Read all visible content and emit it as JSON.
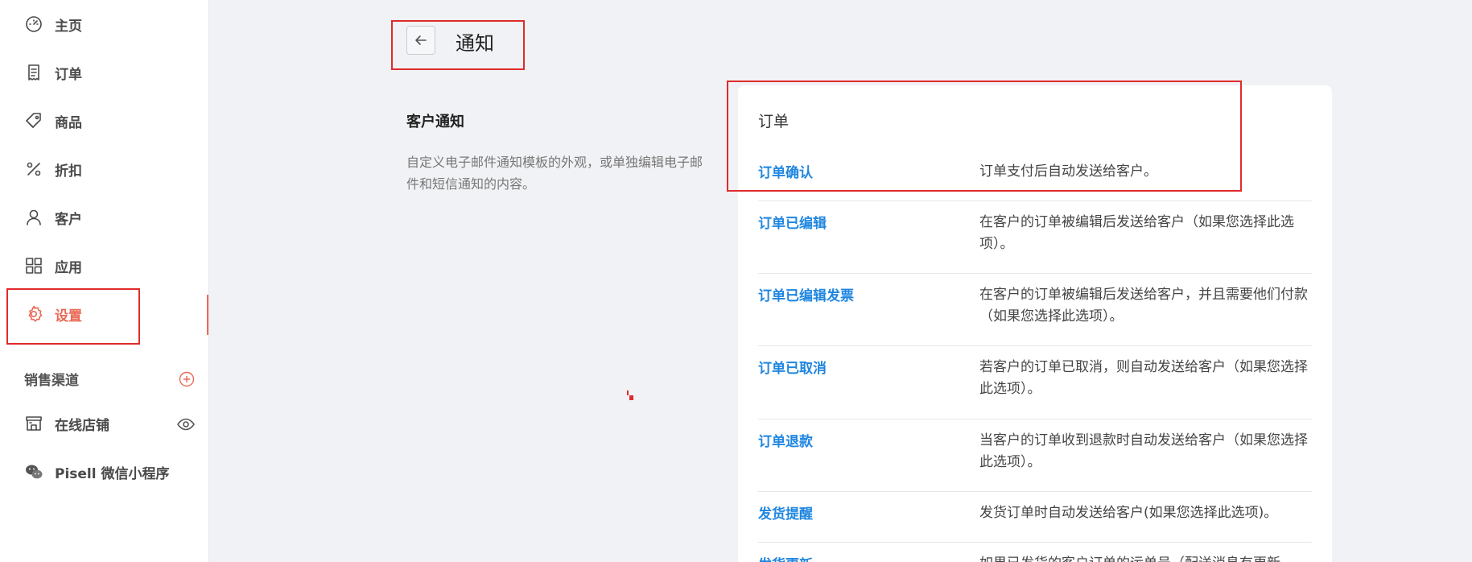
{
  "sidebar": {
    "items": [
      {
        "label": "主页",
        "icon": "dashboard-icon"
      },
      {
        "label": "订单",
        "icon": "receipt-icon"
      },
      {
        "label": "商品",
        "icon": "tag-icon"
      },
      {
        "label": "折扣",
        "icon": "percent-icon"
      },
      {
        "label": "客户",
        "icon": "person-icon"
      },
      {
        "label": "应用",
        "icon": "apps-grid-icon"
      },
      {
        "label": "设置",
        "icon": "gear-icon",
        "active": true
      }
    ],
    "sales_channels_label": "销售渠道",
    "channels": [
      {
        "label": "在线店铺",
        "icon": "store-icon"
      },
      {
        "label": "Pisell 微信小程序",
        "icon": "wechat-icon"
      }
    ],
    "accent_color": "#ea6a57"
  },
  "header": {
    "title": "通知"
  },
  "customer_notifications": {
    "title": "客户通知",
    "description": "自定义电子邮件通知模板的外观，或单独编辑电子邮件和短信通知的内容。"
  },
  "card": {
    "title": "订单",
    "rows": [
      {
        "name": "订单确认",
        "desc": "订单支付后自动发送给客户。"
      },
      {
        "name": "订单已编辑",
        "desc": "在客户的订单被编辑后发送给客户（如果您选择此选项）。"
      },
      {
        "name": "订单已编辑发票",
        "desc": "在客户的订单被编辑后发送给客户，并且需要他们付款（如果您选择此选项）。"
      },
      {
        "name": "订单已取消",
        "desc": "若客户的订单已取消，则自动发送给客户（如果您选择此选项）。"
      },
      {
        "name": "订单退款",
        "desc": "当客户的订单收到退款时自动发送给客户（如果您选择此选项）。"
      },
      {
        "name": "发货提醒",
        "desc": "发货订单时自动发送给客户(如果您选择此选项)。"
      },
      {
        "name": "发货更新",
        "desc": "如果已发货的客户订单的运单号（配送消息有更新"
      }
    ],
    "link_color": "#1f86e0"
  }
}
